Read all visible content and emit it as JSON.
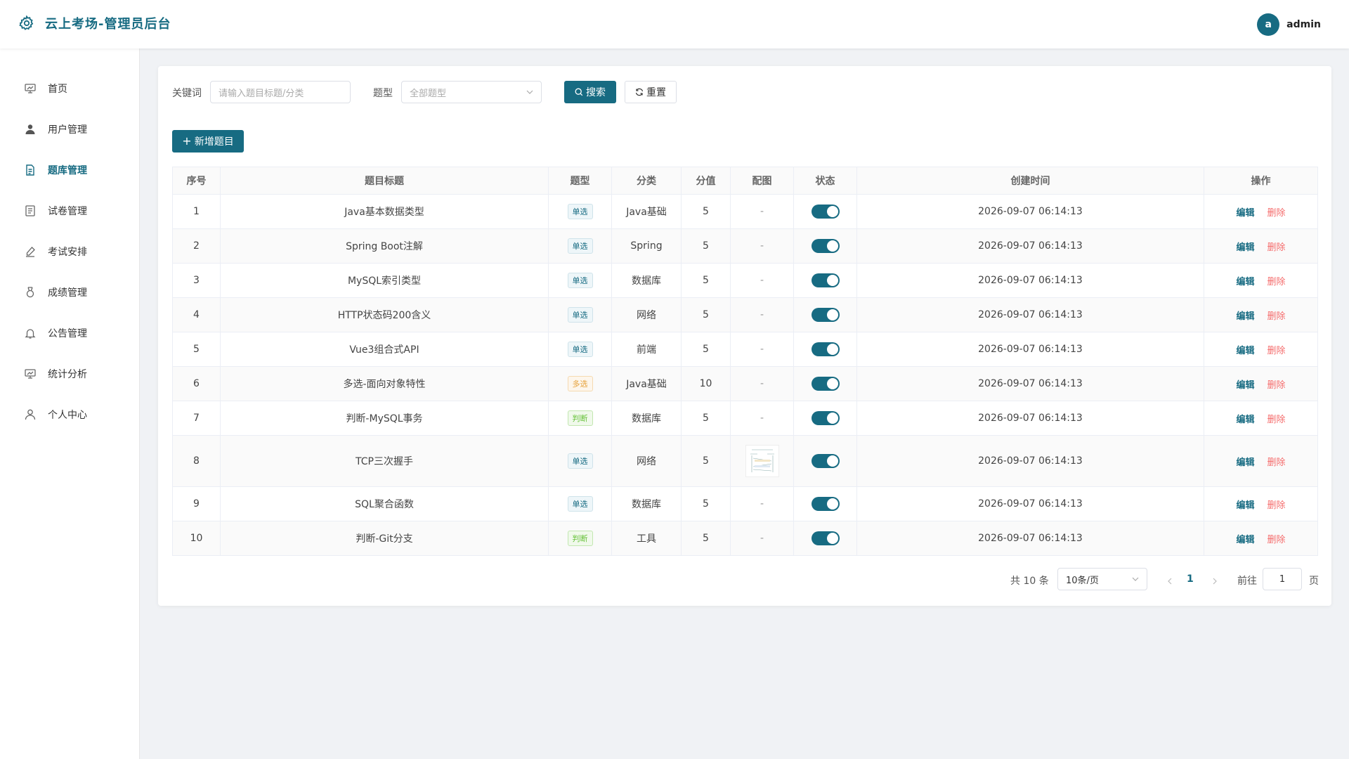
{
  "header": {
    "title": "云上考场-管理员后台",
    "avatar_letter": "a",
    "username": "admin"
  },
  "sidebar": {
    "items": [
      {
        "label": "首页",
        "icon": "monitor-icon"
      },
      {
        "label": "用户管理",
        "icon": "user-icon"
      },
      {
        "label": "题库管理",
        "icon": "document-icon",
        "active": true
      },
      {
        "label": "试卷管理",
        "icon": "paper-icon"
      },
      {
        "label": "考试安排",
        "icon": "edit-pen-icon"
      },
      {
        "label": "成绩管理",
        "icon": "medal-icon"
      },
      {
        "label": "公告管理",
        "icon": "bell-icon"
      },
      {
        "label": "统计分析",
        "icon": "chart-icon"
      },
      {
        "label": "个人中心",
        "icon": "user-outline-icon"
      }
    ]
  },
  "filters": {
    "keyword_label": "关键词",
    "keyword_placeholder": "请输入题目标题/分类",
    "type_label": "题型",
    "type_placeholder": "全部题型",
    "search_label": "搜索",
    "reset_label": "重置"
  },
  "add_button": "新增题目",
  "table": {
    "columns": [
      "序号",
      "题目标题",
      "题型",
      "分类",
      "分值",
      "配图",
      "状态",
      "创建时间",
      "操作"
    ],
    "rows": [
      {
        "no": "1",
        "title": "Java基本数据类型",
        "type": "单选",
        "category": "Java基础",
        "score": "5",
        "image": "-",
        "enabled": true,
        "created": "2026-09-07 06:14:13"
      },
      {
        "no": "2",
        "title": "Spring Boot注解",
        "type": "单选",
        "category": "Spring",
        "score": "5",
        "image": "-",
        "enabled": true,
        "created": "2026-09-07 06:14:13"
      },
      {
        "no": "3",
        "title": "MySQL索引类型",
        "type": "单选",
        "category": "数据库",
        "score": "5",
        "image": "-",
        "enabled": true,
        "created": "2026-09-07 06:14:13"
      },
      {
        "no": "4",
        "title": "HTTP状态码200含义",
        "type": "单选",
        "category": "网络",
        "score": "5",
        "image": "-",
        "enabled": true,
        "created": "2026-09-07 06:14:13"
      },
      {
        "no": "5",
        "title": "Vue3组合式API",
        "type": "单选",
        "category": "前端",
        "score": "5",
        "image": "-",
        "enabled": true,
        "created": "2026-09-07 06:14:13"
      },
      {
        "no": "6",
        "title": "多选-面向对象特性",
        "type": "多选",
        "category": "Java基础",
        "score": "10",
        "image": "-",
        "enabled": true,
        "created": "2026-09-07 06:14:13"
      },
      {
        "no": "7",
        "title": "判断-MySQL事务",
        "type": "判断",
        "category": "数据库",
        "score": "5",
        "image": "-",
        "enabled": true,
        "created": "2026-09-07 06:14:13"
      },
      {
        "no": "8",
        "title": "TCP三次握手",
        "type": "单选",
        "category": "网络",
        "score": "5",
        "image": "thumbnail",
        "enabled": true,
        "created": "2026-09-07 06:14:13"
      },
      {
        "no": "9",
        "title": "SQL聚合函数",
        "type": "单选",
        "category": "数据库",
        "score": "5",
        "image": "-",
        "enabled": true,
        "created": "2026-09-07 06:14:13"
      },
      {
        "no": "10",
        "title": "判断-Git分支",
        "type": "判断",
        "category": "工具",
        "score": "5",
        "image": "-",
        "enabled": true,
        "created": "2026-09-07 06:14:13"
      }
    ],
    "edit_label": "编辑",
    "delete_label": "删除"
  },
  "pagination": {
    "total_text": "共 10 条",
    "page_size": "10条/页",
    "current_page": "1",
    "goto_label": "前往",
    "goto_value": "1",
    "page_suffix": "页"
  },
  "colors": {
    "primary": "#176b82",
    "danger": "#f56c6c",
    "warning": "#e6a23c",
    "success": "#67c23a"
  }
}
